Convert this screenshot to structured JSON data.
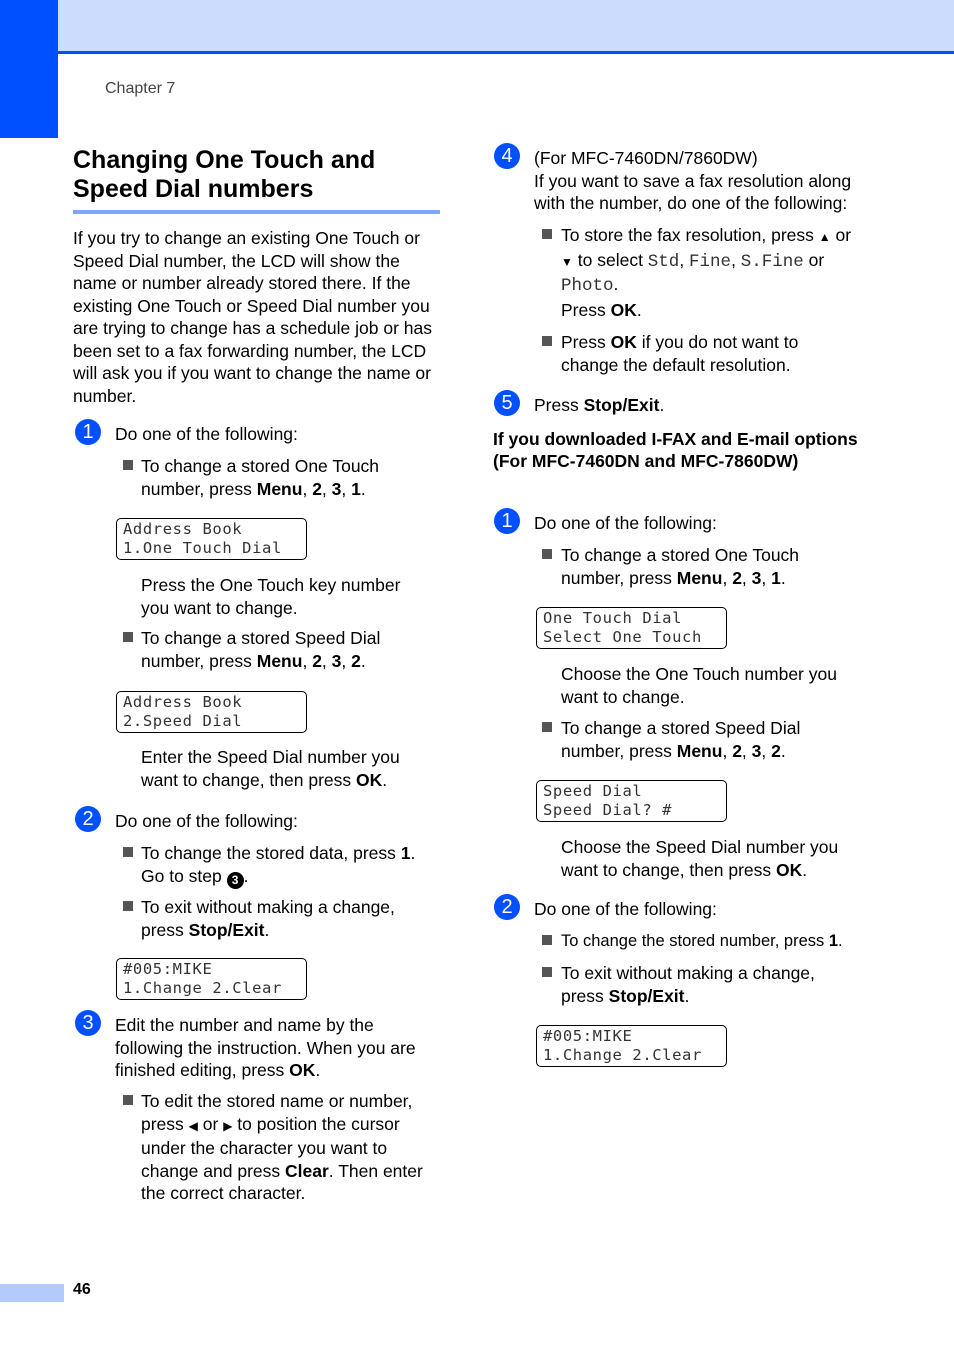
{
  "header": {
    "chapter": "Chapter 7"
  },
  "title": "Changing One Touch and Speed Dial numbers",
  "intro": "If you try to change an existing One Touch or Speed Dial number, the LCD will show the name or number already stored there. If the existing One Touch or Speed Dial number you are trying to change has a schedule job or has been set to a fax forwarding number, the LCD will ask you if you want to change the name or number.",
  "left": {
    "step1": {
      "num": "1",
      "text": "Do one of the following:",
      "bullet1_text": "To change a stored One Touch number, press ",
      "bullet1_keys": [
        "Menu",
        "2",
        "3",
        "1"
      ],
      "lcd1": [
        "Address Book",
        "1.One Touch Dial"
      ],
      "after1": "Press the One Touch key number you want to change.",
      "bullet2_text": "To change a stored Speed Dial number, press ",
      "bullet2_keys": [
        "Menu",
        "2",
        "3",
        "2"
      ],
      "lcd2": [
        "Address Book",
        "2.Speed Dial"
      ],
      "after2_text": "Enter the Speed Dial number you want to change, then press ",
      "after2_key": "OK"
    },
    "step2": {
      "num": "2",
      "text": "Do one of the following:",
      "bullet1_text": "To change the stored data, press ",
      "bullet1_key": "1",
      "bullet1_goto": "Go to step ",
      "bullet1_step": "3",
      "bullet2_text": "To exit without making a change, press ",
      "bullet2_key": "Stop/Exit",
      "lcd": [
        "#005:MIKE",
        "1.Change 2.Clear"
      ]
    },
    "step3": {
      "num": "3",
      "text": "Edit the number and name by the following the instruction. When you are finished editing, press ",
      "text_key": "OK",
      "bullet1_a": "To edit the stored name or number, press ",
      "bullet1_b": " or ",
      "bullet1_c": " to position the cursor under the character you want to change and press ",
      "bullet1_key": "Clear",
      "bullet1_d": ". Then enter the correct character."
    }
  },
  "right": {
    "step4": {
      "num": "4",
      "line1": "(For MFC-7460DN/7860DW)",
      "line2": "If you want to save a fax resolution along with the number, do one of the following:",
      "bullet1_a": "To store the fax resolution, press ",
      "bullet1_or": " or",
      "bullet1_b": " to select ",
      "resolutions": [
        "Std",
        "Fine",
        "S.Fine",
        "Photo"
      ],
      "press": "Press ",
      "press_key": "OK",
      "bullet2_a": "Press ",
      "bullet2_key": "OK",
      "bullet2_b": " if you do not want to change the default resolution."
    },
    "step5": {
      "num": "5",
      "text": "Press ",
      "key": "Stop/Exit"
    },
    "subheading": [
      "If you downloaded I-FAX and E-mail options",
      "(For MFC-7460DN and MFC-7860DW)"
    ],
    "step1": {
      "num": "1",
      "text": "Do one of the following:",
      "bullet1_text": "To change a stored One Touch number, press ",
      "bullet1_keys": [
        "Menu",
        "2",
        "3",
        "1"
      ],
      "lcd1": [
        "One Touch Dial",
        "Select One Touch"
      ],
      "after1": "Choose the One Touch number you want to change.",
      "bullet2_text": "To change a stored Speed Dial number, press ",
      "bullet2_keys": [
        "Menu",
        "2",
        "3",
        "2"
      ],
      "lcd2": [
        "Speed Dial",
        "Speed Dial? #"
      ],
      "after2_text": "Choose the Speed Dial number you want to change, then press ",
      "after2_key": "OK"
    },
    "step2": {
      "num": "2",
      "text": "Do one of the following:",
      "bullet1_text": "To change the stored number, press ",
      "bullet1_key": "1",
      "bullet2_text": "To exit without making a change, press ",
      "bullet2_key": "Stop/Exit",
      "lcd": [
        "#005:MIKE",
        "1.Change 2.Clear"
      ]
    }
  },
  "footer": {
    "page_number": "46"
  },
  "colors": {
    "accent": "#0050ff",
    "band": "#ccdcfc",
    "rule": "#7fa6fc"
  }
}
